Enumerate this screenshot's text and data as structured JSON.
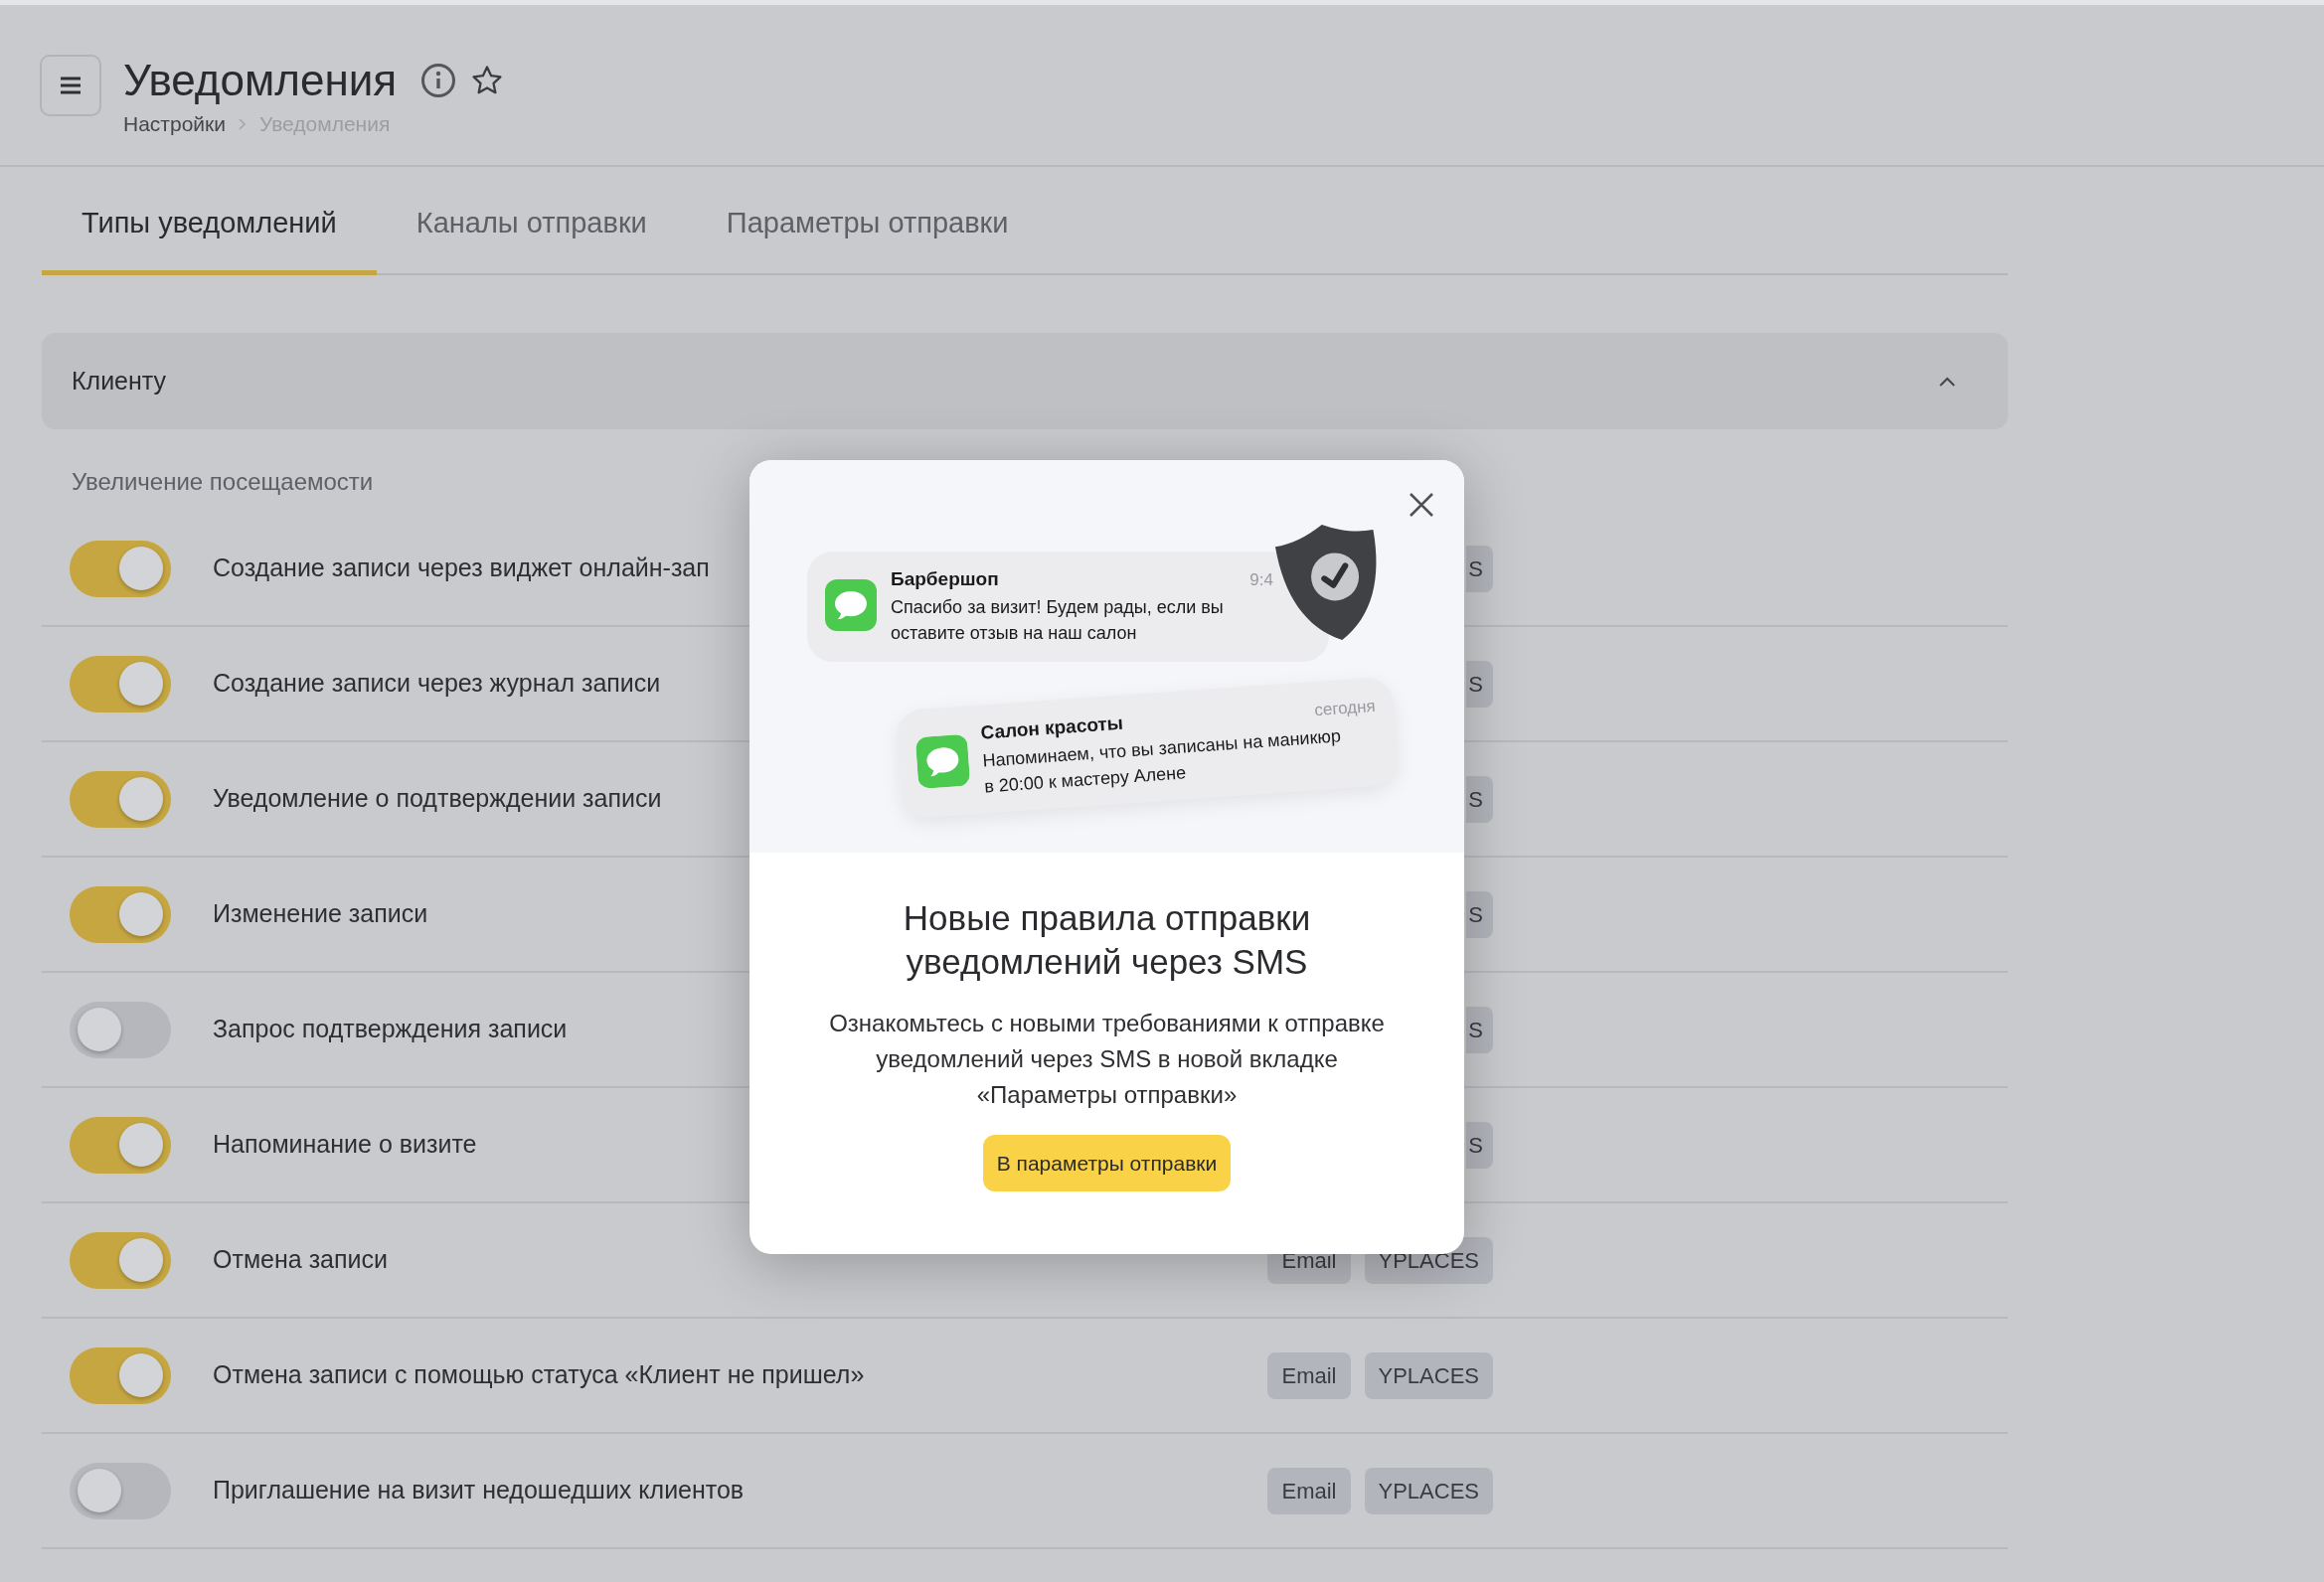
{
  "header": {
    "title": "Уведомления",
    "breadcrumbs": [
      {
        "label": "Настройки",
        "current": false
      },
      {
        "label": "Уведомления",
        "current": true
      }
    ]
  },
  "tabs": [
    {
      "label": "Типы уведомлений",
      "selected": true
    },
    {
      "label": "Каналы отправки",
      "selected": false
    },
    {
      "label": "Параметры отправки",
      "selected": false
    }
  ],
  "section": {
    "title": "Клиенту",
    "expanded": true,
    "group_title": "Увеличение посещаемости",
    "rows": [
      {
        "label": "Создание записи через виджет онлайн-зап",
        "on": true,
        "tags": [
          "S"
        ],
        "tags_clipped": true
      },
      {
        "label": "Создание записи через журнал записи",
        "on": true,
        "tags": [
          "S"
        ],
        "tags_clipped": true
      },
      {
        "label": "Уведомление о подтверждении записи",
        "on": true,
        "tags": [
          "S"
        ],
        "tags_clipped": true
      },
      {
        "label": "Изменение записи",
        "on": true,
        "tags": [
          "S"
        ],
        "tags_clipped": true
      },
      {
        "label": "Запрос подтверждения записи",
        "on": false,
        "tags": [
          "S"
        ],
        "tags_clipped": true
      },
      {
        "label": "Напоминание о визите",
        "on": true,
        "tags": [
          "S"
        ],
        "tags_clipped": true
      },
      {
        "label": "Отмена записи",
        "on": true,
        "tags": [
          "Email",
          "YPLACES"
        ],
        "tags_clipped": false
      },
      {
        "label": "Отмена записи с помощью статуса «Клиент не пришел»",
        "on": true,
        "tags": [
          "Email",
          "YPLACES"
        ],
        "tags_clipped": false
      },
      {
        "label": "Приглашение на визит недошедших клиентов",
        "on": false,
        "tags": [
          "Email",
          "YPLACES"
        ],
        "tags_clipped": false
      }
    ]
  },
  "modal": {
    "notifications": [
      {
        "sender": "Барбершоп",
        "time": "9:4",
        "text": "Спасибо за визит! Будем рады, если вы оставите отзыв на наш салон"
      },
      {
        "sender": "Салон красоты",
        "time": "сегодня",
        "text": "Напоминаем, что вы записаны на маникюр в 20:00 к мастеру Алене"
      }
    ],
    "title": "Новые правила отправки уведомлений через SMS",
    "text": "Ознакомьтесь с новыми требованиями к отправке уведомлений через SMS в новой вкладке «Параметры отправки»",
    "button": "В параметры отправки"
  }
}
